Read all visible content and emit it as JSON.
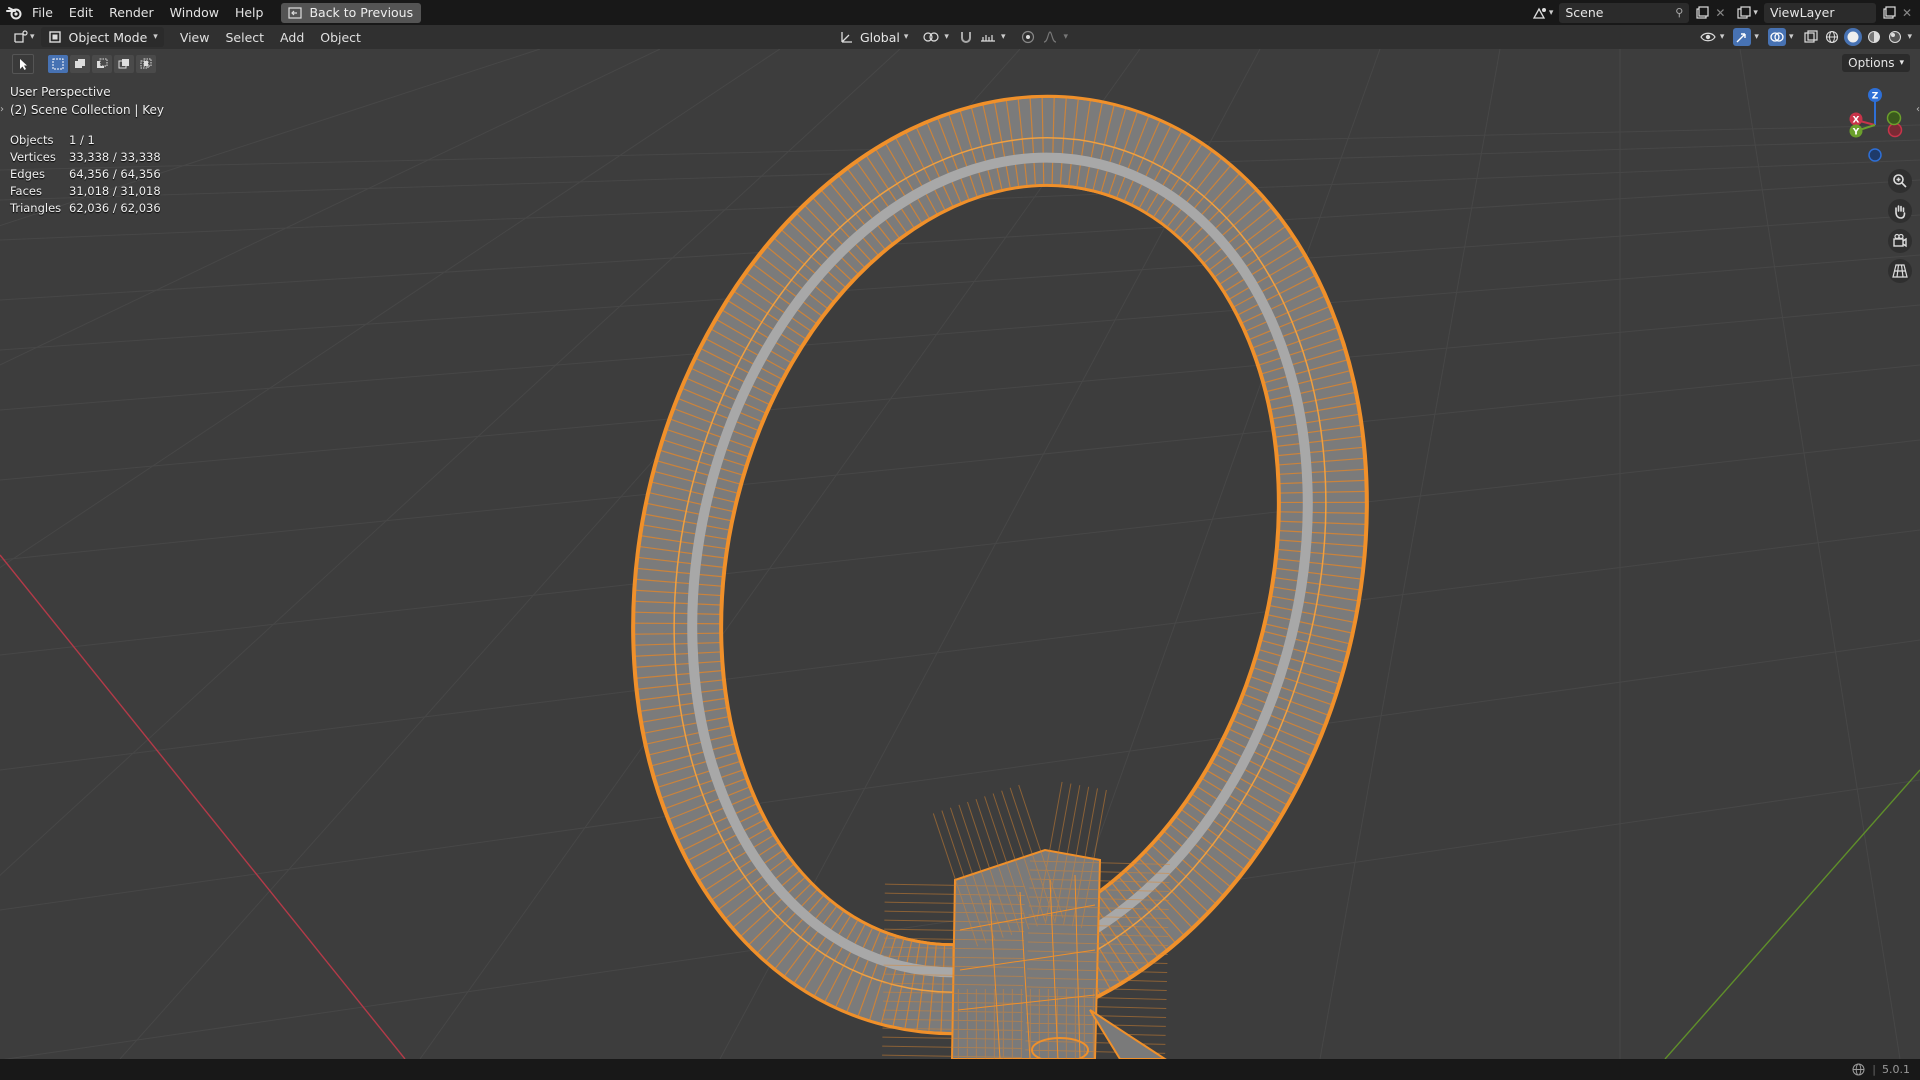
{
  "topbar": {
    "menu": [
      "File",
      "Edit",
      "Render",
      "Window",
      "Help"
    ],
    "back_button": "Back to Previous",
    "scene_name": "Scene",
    "view_layer": "ViewLayer"
  },
  "header": {
    "mode": "Object Mode",
    "menus": [
      "View",
      "Select",
      "Add",
      "Object"
    ],
    "transform_orientation": "Global",
    "options_label": "Options"
  },
  "viewport": {
    "perspective": "User Perspective",
    "collection": "(2) Scene Collection | Key",
    "stats": [
      {
        "label": "Objects",
        "value": "1 / 1"
      },
      {
        "label": "Vertices",
        "value": "33,338 / 33,338"
      },
      {
        "label": "Edges",
        "value": "64,356 / 64,356"
      },
      {
        "label": "Faces",
        "value": "31,018 / 31,018"
      },
      {
        "label": "Triangles",
        "value": "62,036 / 62,036"
      }
    ],
    "gizmo": {
      "x": "X",
      "y": "Y",
      "z": "Z"
    }
  },
  "statusbar": {
    "version": "5.0.1"
  },
  "colors": {
    "selection_orange": "#f0902a",
    "x_axis": "#c8344a",
    "y_axis": "#6ba02c",
    "z_axis": "#2e6fd6",
    "accent_blue": "#4772b3"
  }
}
